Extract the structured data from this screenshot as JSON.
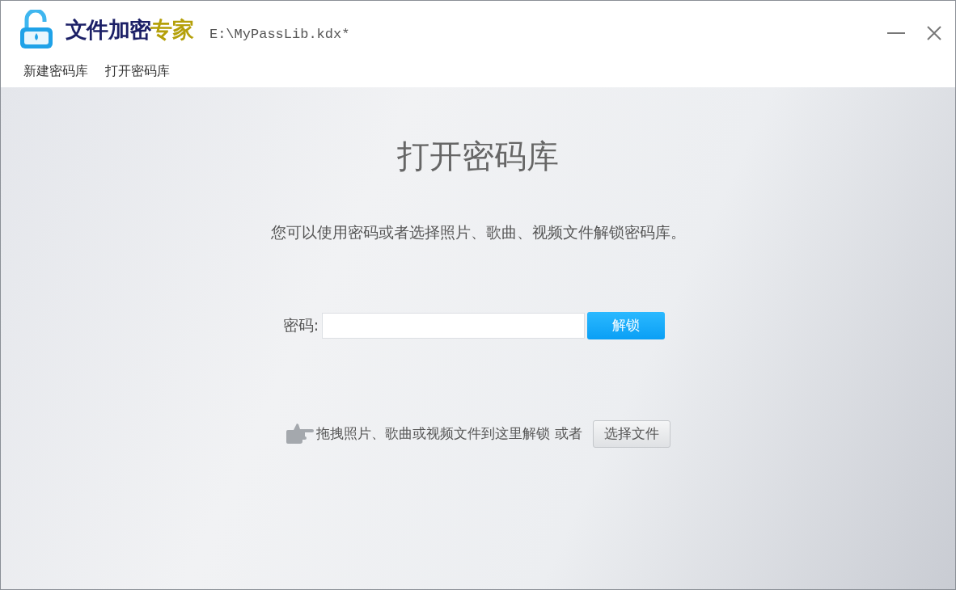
{
  "window": {
    "logo_text": "文件加密",
    "logo_accent": "专家",
    "file_path": "E:\\MyPassLib.kdx*"
  },
  "menu": [
    "新建密码库",
    "打开密码库"
  ],
  "main": {
    "title": "打开密码库",
    "subtitle": "您可以使用密码或者选择照片、歌曲、视频文件解锁密码库。",
    "password_label": "密码:",
    "unlock_button": "解锁",
    "drop_hint": "拖拽照片、歌曲或视频文件到这里解锁",
    "or_text": "或者",
    "choose_button": "选择文件"
  }
}
